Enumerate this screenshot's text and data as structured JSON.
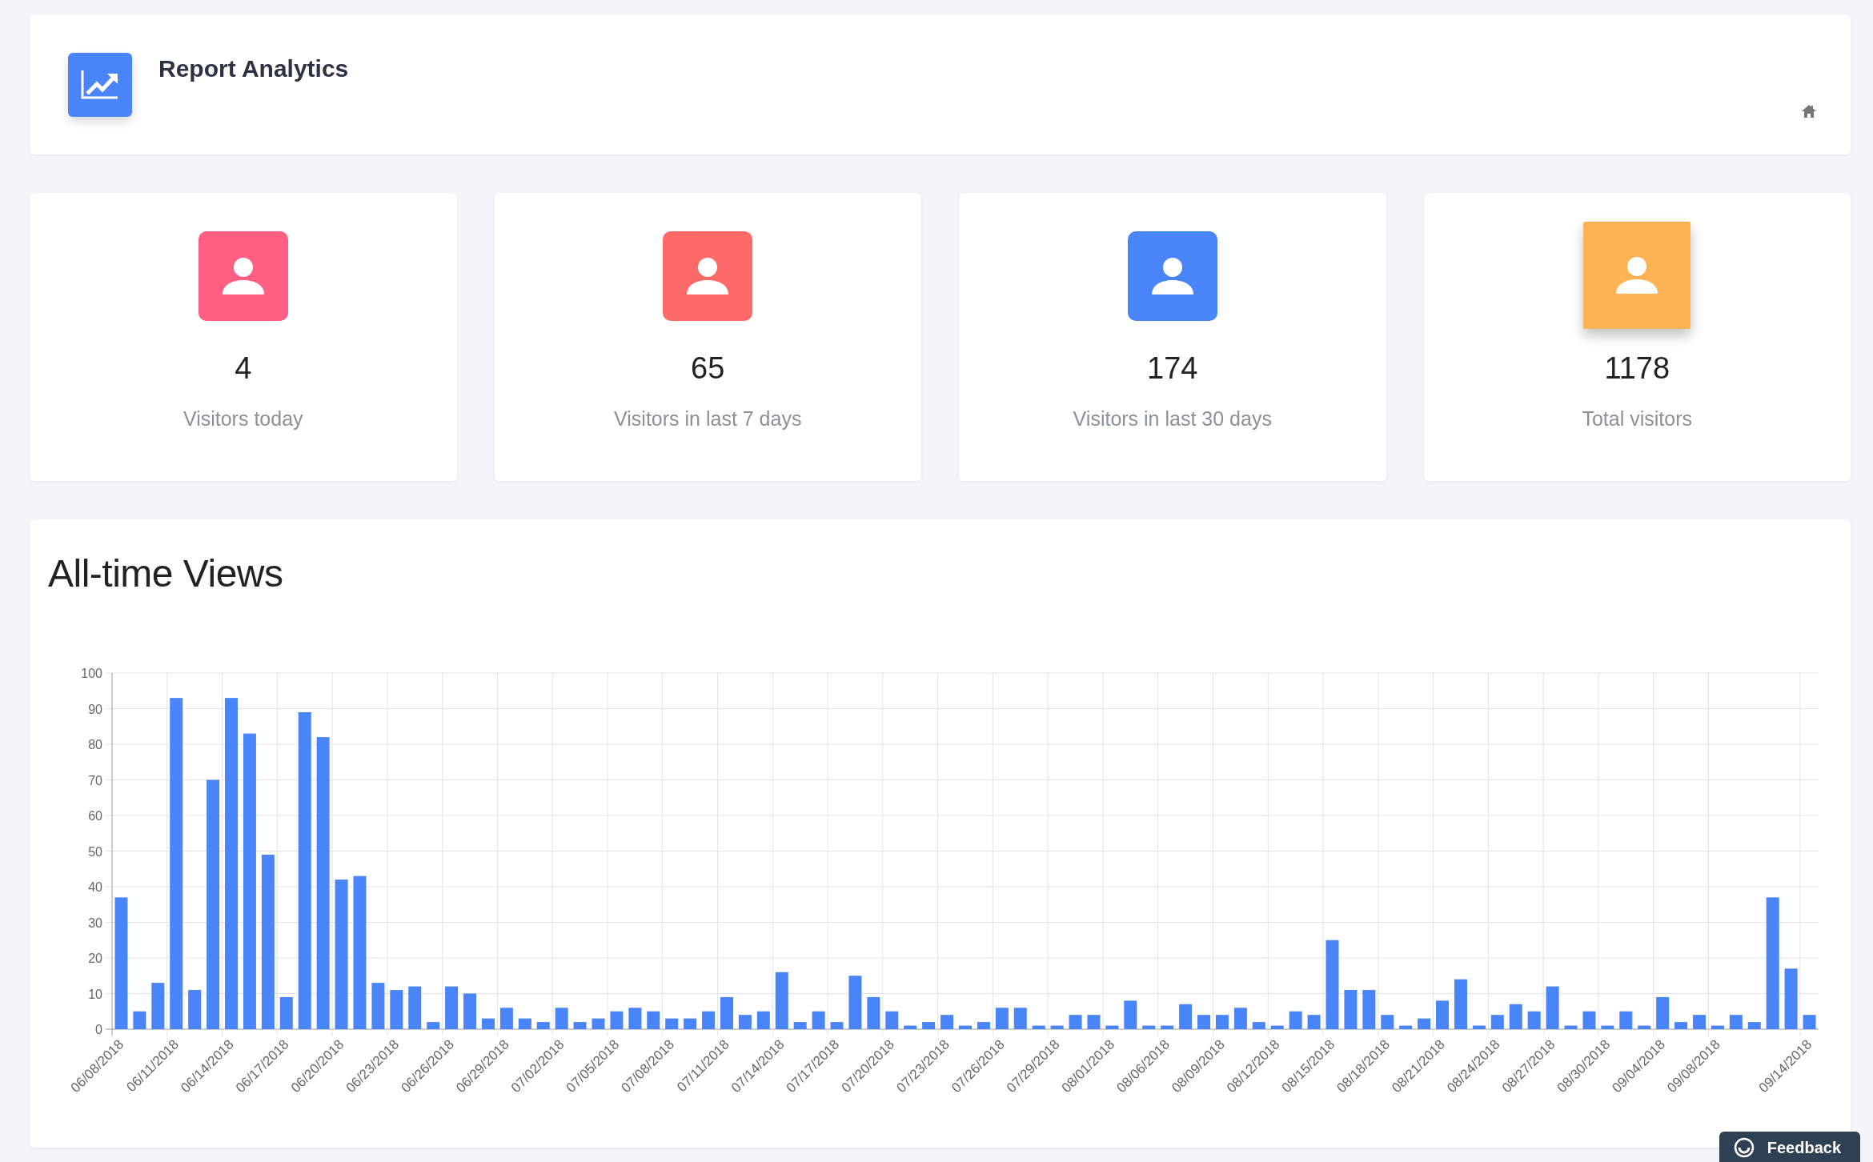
{
  "header": {
    "title": "Report Analytics"
  },
  "stats": [
    {
      "value": "4",
      "label": "Visitors today",
      "color": "#fe5f82",
      "raised": false
    },
    {
      "value": "65",
      "label": "Visitors in last 7 days",
      "color": "#fc6a68",
      "raised": false
    },
    {
      "value": "174",
      "label": "Visitors in last 30 days",
      "color": "#4a84f9",
      "raised": false
    },
    {
      "value": "1178",
      "label": "Total visitors",
      "color": "#fdb254",
      "raised": true
    }
  ],
  "views": {
    "title": "All-time Views",
    "chart_data": {
      "type": "bar",
      "categories": [
        "06/08/2018",
        null,
        null,
        "06/11/2018",
        null,
        null,
        "06/14/2018",
        null,
        null,
        "06/17/2018",
        null,
        null,
        "06/20/2018",
        null,
        null,
        "06/23/2018",
        null,
        null,
        "06/26/2018",
        null,
        null,
        "06/29/2018",
        null,
        null,
        "07/02/2018",
        null,
        null,
        "07/05/2018",
        null,
        null,
        "07/08/2018",
        null,
        null,
        "07/11/2018",
        null,
        null,
        "07/14/2018",
        null,
        null,
        "07/17/2018",
        null,
        null,
        "07/20/2018",
        null,
        null,
        "07/23/2018",
        null,
        null,
        "07/26/2018",
        null,
        null,
        "07/29/2018",
        null,
        null,
        "08/01/2018",
        null,
        null,
        "08/06/2018",
        null,
        null,
        "08/09/2018",
        null,
        null,
        "08/12/2018",
        null,
        null,
        "08/15/2018",
        null,
        null,
        "08/18/2018",
        null,
        null,
        "08/21/2018",
        null,
        null,
        "08/24/2018",
        null,
        null,
        "08/27/2018",
        null,
        null,
        "08/30/2018",
        null,
        null,
        "09/04/2018",
        null,
        null,
        "09/08/2018",
        null,
        null,
        null,
        null,
        "09/14/2018"
      ],
      "values": [
        37,
        5,
        13,
        93,
        11,
        70,
        93,
        83,
        49,
        9,
        89,
        82,
        42,
        43,
        13,
        11,
        12,
        2,
        12,
        10,
        3,
        6,
        3,
        2,
        6,
        2,
        3,
        5,
        6,
        5,
        3,
        3,
        5,
        9,
        4,
        5,
        16,
        2,
        5,
        2,
        15,
        9,
        5,
        1,
        2,
        4,
        1,
        2,
        6,
        6,
        1,
        1,
        4,
        4,
        1,
        8,
        1,
        1,
        7,
        4,
        4,
        6,
        2,
        1,
        5,
        4,
        25,
        11,
        11,
        4,
        1,
        3,
        8,
        14,
        1,
        4,
        7,
        5,
        12,
        1,
        5,
        1,
        5,
        1,
        9,
        2,
        4,
        1,
        4,
        2,
        37,
        17,
        4
      ],
      "grid": true,
      "ylim": [
        0,
        100
      ],
      "yticks": [
        0,
        10,
        20,
        30,
        40,
        50,
        60,
        70,
        80,
        90,
        100
      ]
    }
  },
  "feedback": {
    "label": "Feedback"
  }
}
